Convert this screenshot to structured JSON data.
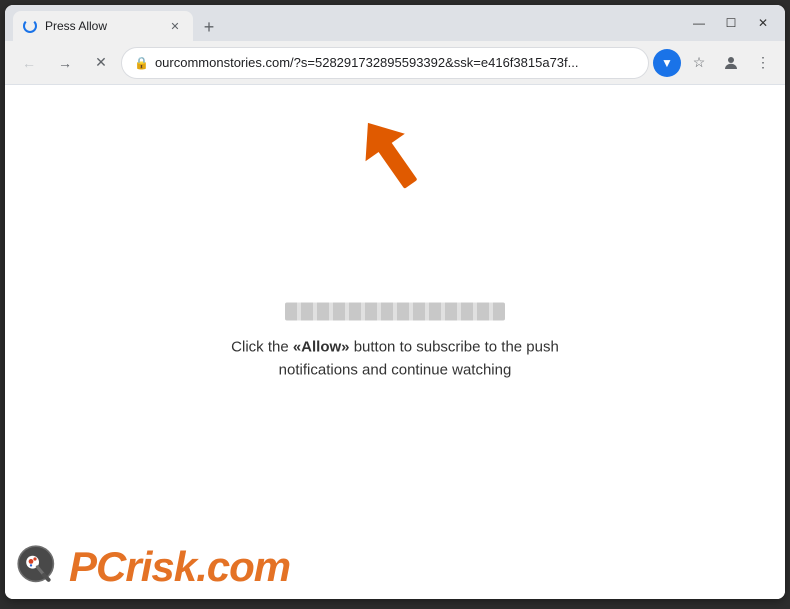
{
  "browser": {
    "title_bar": {
      "tab_title": "Press Allow",
      "new_tab_aria": "New tab",
      "window_controls": {
        "minimize": "—",
        "maximize": "☐",
        "close": "✕"
      }
    },
    "nav_bar": {
      "back_aria": "Back",
      "forward_aria": "Forward",
      "stop_aria": "Stop loading",
      "url": "ourcommonstories.com/?s=528291732895593392&ssk=e416f3815a73f...",
      "bookmark_aria": "Bookmark",
      "profile_aria": "Profile",
      "menu_aria": "Menu",
      "download_aria": "Downloads"
    },
    "page": {
      "subscribe_text_pre": "Click the ",
      "subscribe_allow": "«Allow»",
      "subscribe_text_post": " button to subscribe to the push notifications and continue watching",
      "pcrisk_brand": "risk.com",
      "pcrisk_prefix": "PC"
    }
  }
}
